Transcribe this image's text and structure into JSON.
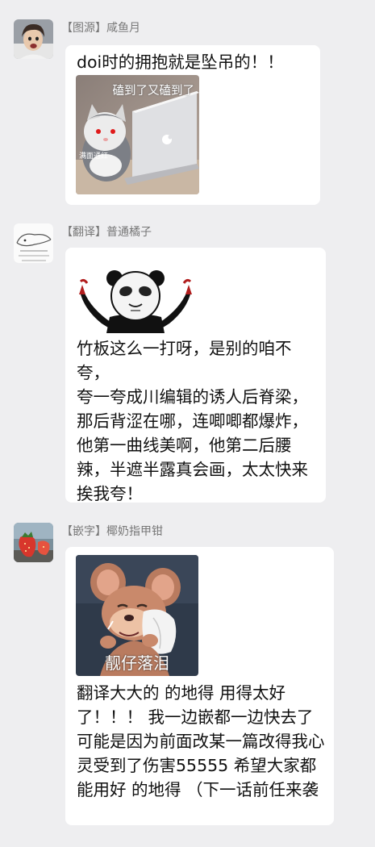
{
  "messages": [
    {
      "sender": "【图源】咸鱼月",
      "text": "doi时的拥抱就是坠吊的！！",
      "sticker": {
        "name": "cat-laptop-sticker",
        "caption_top": "磕到了又磕到了",
        "caption_side": "满面通红"
      }
    },
    {
      "sender": "【翻译】普通橘子",
      "text": "竹板这么一打呀，是别的咱不夸，\n夸一夸成川编辑的诱人后脊梁，那后背涩在哪，连唧唧都爆炸，他第一曲线美啊，他第二后腰辣，半遮半露真会画，太太快来挨我夸！",
      "sticker": {
        "name": "panda-cheer-sticker"
      }
    },
    {
      "sender": "【嵌字】椰奶指甲钳",
      "text": "翻译大大的 的地得 用得太好了！！！ 我一边嵌都一边快去了 可能是因为前面改某一篇改得我心灵受到了伤害55555 希望大家都能用好 的地得 （下一话前任来袭",
      "sticker": {
        "name": "jerry-crying-sticker",
        "caption": "靓仔落泪"
      }
    }
  ]
}
